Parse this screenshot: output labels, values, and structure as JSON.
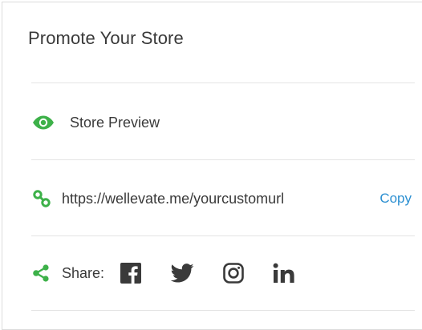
{
  "panel": {
    "title": "Promote Your Store"
  },
  "preview": {
    "icon": "eye-icon",
    "label": "Store Preview"
  },
  "url": {
    "icon": "link-icon",
    "value": "https://wellevate.me/yourcustomurl",
    "copy_label": "Copy"
  },
  "share": {
    "icon": "share-icon",
    "label": "Share:",
    "networks": [
      {
        "name": "Facebook",
        "icon": "facebook-icon"
      },
      {
        "name": "Twitter",
        "icon": "twitter-icon"
      },
      {
        "name": "Instagram",
        "icon": "instagram-icon"
      },
      {
        "name": "LinkedIn",
        "icon": "linkedin-icon"
      }
    ]
  },
  "colors": {
    "accent_green": "#3db149",
    "link_blue": "#2b8fd1",
    "social_gray": "#3a3a3a",
    "divider": "#e4e4e4"
  }
}
